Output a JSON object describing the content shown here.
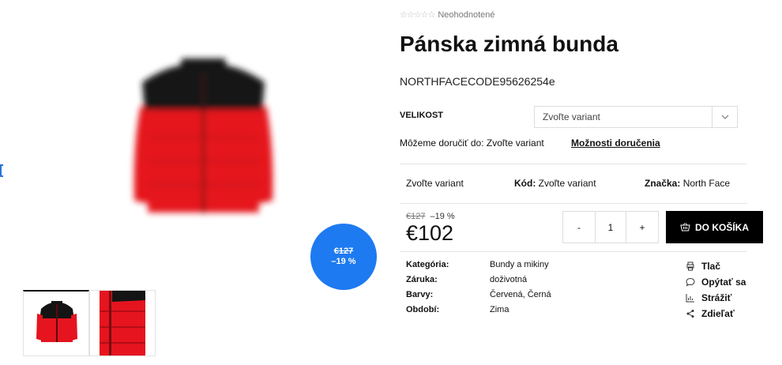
{
  "product": {
    "rating_text": "Neohodnotené",
    "rating_stars": "☆☆☆☆☆",
    "title": "Pánska zimná bunda",
    "code": "NORTHFACECODE95626254e"
  },
  "variant": {
    "label": "VELIKOST",
    "placeholder": "Zvoľte variant",
    "chevron_icon": "chevron-down-icon"
  },
  "delivery": {
    "text": "Môžeme doručiť do: Zvoľte variant",
    "link": "Možnosti doručenia"
  },
  "info": {
    "availability": "Zvoľte variant",
    "code_label": "Kód:",
    "code_value": "Zvoľte variant",
    "brand_label": "Značka:",
    "brand_value": "North Face"
  },
  "price": {
    "old": "€127",
    "discount": "–19 %",
    "current": "€102"
  },
  "badge": {
    "old": "€127",
    "discount": "–19 %",
    "color": "#1e7af0"
  },
  "quantity": {
    "minus": "-",
    "value": "1",
    "plus": "+"
  },
  "cart": {
    "label": "DO KOŠÍKA",
    "icon": "basket-icon"
  },
  "meta": [
    {
      "key": "Kategória:",
      "value": "Bundy a mikiny"
    },
    {
      "key": "Záruka:",
      "value": "doživotná"
    },
    {
      "key": "Barvy:",
      "value": "Červená, Černá"
    },
    {
      "key": "Období:",
      "value": "Zima"
    }
  ],
  "actions": [
    {
      "label": "Tlač",
      "icon": "print-icon"
    },
    {
      "label": "Opýtať sa",
      "icon": "chat-icon"
    },
    {
      "label": "Strážiť",
      "icon": "chart-icon"
    },
    {
      "label": "Zdieľať",
      "icon": "share-icon"
    }
  ],
  "colors": {
    "jacket_red": "#e5141f",
    "jacket_black": "#141414",
    "accent_blue": "#1e7af0"
  }
}
